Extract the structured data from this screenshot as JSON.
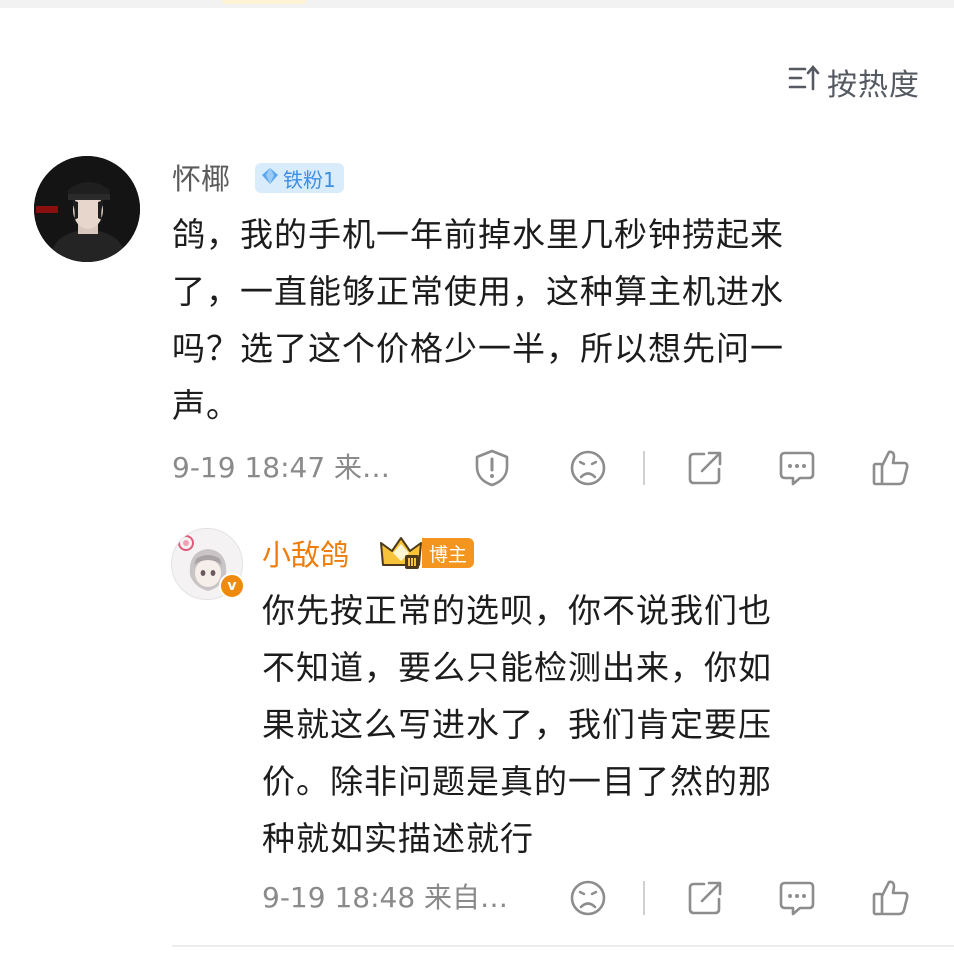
{
  "sort": {
    "label": "按热度",
    "icon": "sort-icon"
  },
  "comment": {
    "username": "怀椰",
    "fan_badge": "铁粉1",
    "text": "鸽，我的手机一年前掉水里几秒钟捞起来\n了，一直能够正常使用，这种算主机进水\n吗？选了这个价格少一半，所以想先问一\n声。",
    "meta": "9-19 18:47  来…",
    "actions": [
      "report-icon",
      "dislike-icon",
      "share-icon",
      "reply-icon",
      "like-icon"
    ]
  },
  "reply": {
    "username": "小敌鸽",
    "badge": "博主",
    "verified_mark": "v",
    "text": "你先按正常的选呗，你不说我们也\n不知道，要么只能检测出来，你如\n果就这么写进水了，我们肯定要压\n价。除非问题是真的一目了然的那\n种就如实描述就行",
    "meta": "9-19 18:48  来自…",
    "actions": [
      "dislike-icon",
      "share-icon",
      "reply-icon",
      "like-icon"
    ]
  },
  "colors": {
    "accent_orange": "#ee7d0c",
    "fan_blue": "#3f8ee6",
    "meta_gray": "#8a8a8a"
  }
}
